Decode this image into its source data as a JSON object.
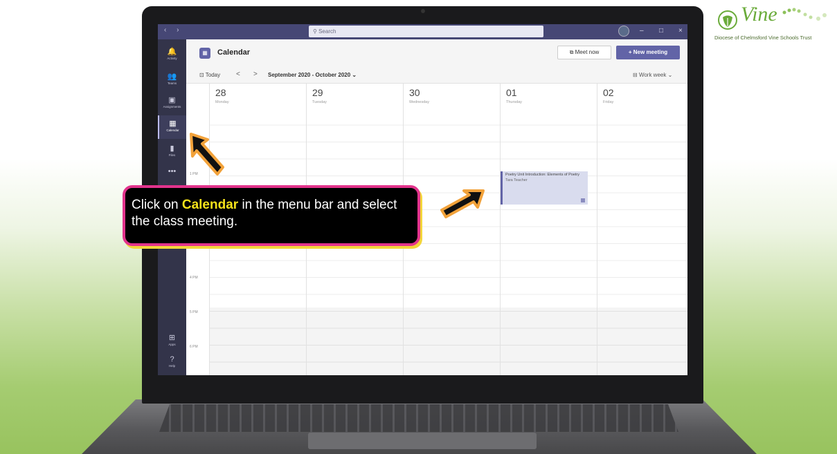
{
  "logo": {
    "word": "Vine",
    "tagline": "Diocese of Chelmsford Vine Schools Trust"
  },
  "titlebar": {
    "nav": "‹ ›",
    "search_placeholder": "Search",
    "minimize": "–",
    "maximize": "□",
    "close": "×"
  },
  "rail": [
    {
      "label": "Activity",
      "icon": "bell-icon",
      "glyph": "🔔"
    },
    {
      "label": "Teams",
      "icon": "teams-icon",
      "glyph": "👥"
    },
    {
      "label": "Assignments",
      "icon": "assignments-icon",
      "glyph": "▣"
    },
    {
      "label": "Calendar",
      "icon": "calendar-icon",
      "glyph": "▦"
    },
    {
      "label": "Files",
      "icon": "files-icon",
      "glyph": "▮"
    },
    {
      "label": "",
      "icon": "more-icon",
      "glyph": "•••"
    },
    {
      "label": "Apps",
      "icon": "apps-icon",
      "glyph": "⊞"
    },
    {
      "label": "Help",
      "icon": "help-icon",
      "glyph": "?"
    }
  ],
  "header": {
    "title": "Calendar",
    "meet_now": "Meet now",
    "new_meeting": "+ New meeting"
  },
  "toolbar": {
    "today": "Today",
    "prev": "<",
    "next": ">",
    "range": "September 2020 - October 2020",
    "view": "Work week"
  },
  "days": [
    {
      "num": "28",
      "name": "Monday"
    },
    {
      "num": "29",
      "name": "Tuesday"
    },
    {
      "num": "30",
      "name": "Wednesday"
    },
    {
      "num": "01",
      "name": "Thursday"
    },
    {
      "num": "02",
      "name": "Friday"
    }
  ],
  "time_labels": [
    "1 PM",
    "4 PM",
    "5 PM",
    "6 PM"
  ],
  "event": {
    "title": "Poetry Unit Introduction: Elements of Poetry",
    "organizer": "Tara Teacher"
  },
  "callout": {
    "prefix": "Click on ",
    "highlight": "Calendar",
    "suffix": " in the menu bar and select the class meeting."
  },
  "colors": {
    "teams_purple": "#6264a7",
    "callout_border": "#e2338c",
    "highlight": "#f5e21a"
  }
}
